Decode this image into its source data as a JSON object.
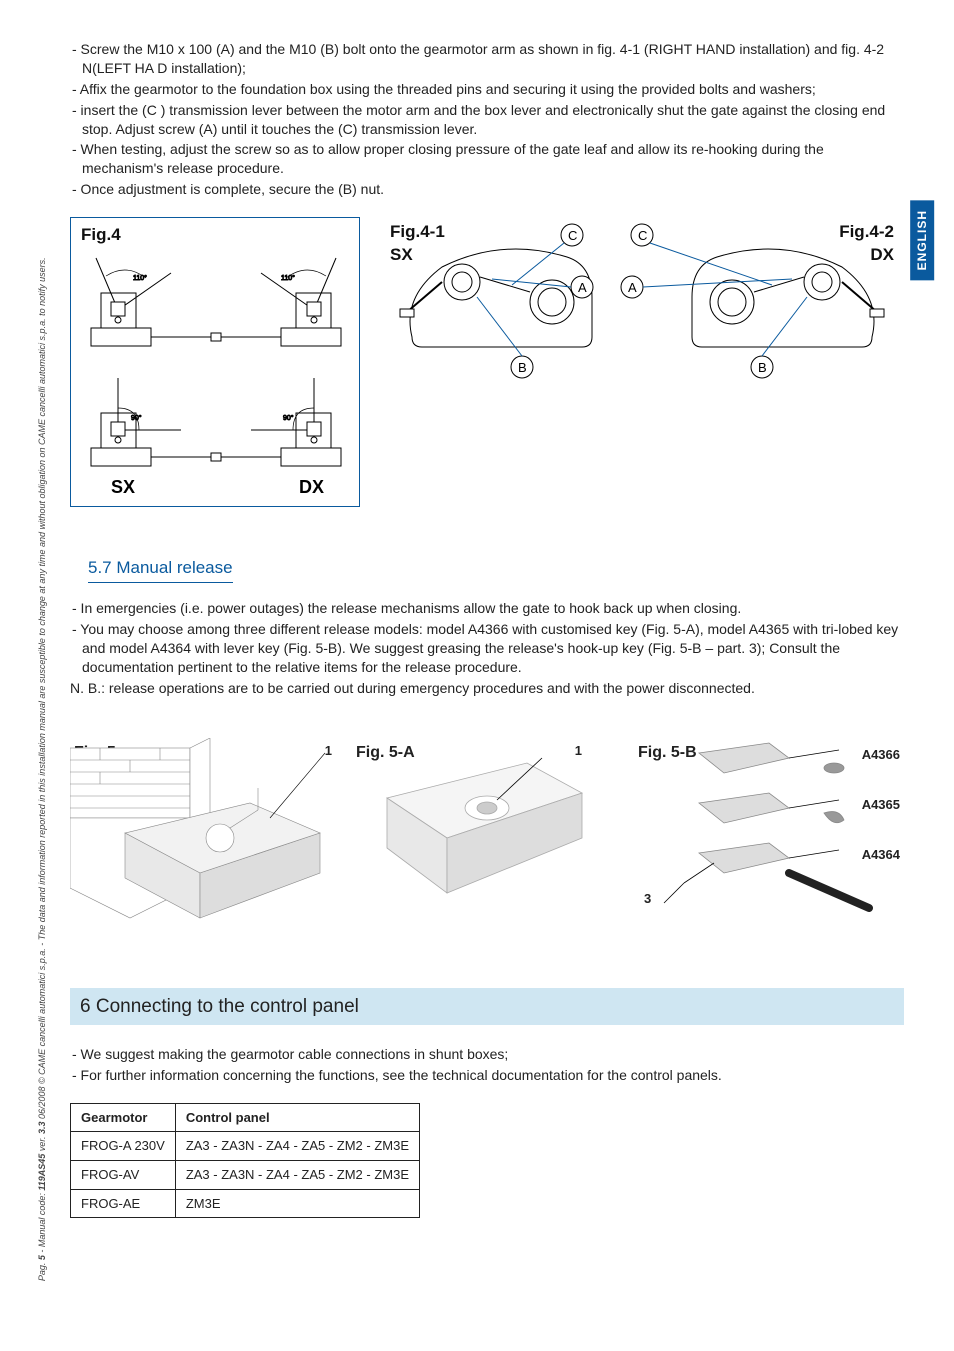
{
  "sideText": {
    "prefix": "Pag. ",
    "page": "5",
    "mid1": " - Manual code: ",
    "code": "119AS45",
    "mid2": " ver. ",
    "ver": "3.3",
    "rest": "  06/2008 © CAME cancelli automatici s.p.a. - The data and information reported in this installation manual are susceptible to change at any time and without obligation on CAME cancelli automatici s.p.a. to notify users."
  },
  "langTab": "ENGLISH",
  "topInstructions": [
    "- Screw the M10 x 100 (A) and the M10 (B) bolt onto the gearmotor arm as shown in fig. 4-1 (RIGHT HAND installation) and fig. 4-2 N(LEFT HA D installation);",
    "- Affix the gearmotor to the foundation box using the threaded pins and securing it using the provided bolts and washers;",
    "- insert the (C ) transmission lever between the motor arm and the box lever and electronically shut the gate against the closing end stop. Adjust screw (A) until it touches the (C) transmission lever.",
    "- When testing, adjust the screw so as to allow proper closing pressure of the gate leaf and allow its re-hooking during the mechanism's release procedure.",
    "- Once adjustment is complete, secure the (B) nut."
  ],
  "fig4": {
    "label": "Fig.4",
    "sx": "SX",
    "dx": "DX",
    "ang110": "110°",
    "ang90": "90°"
  },
  "fig41": {
    "labelL1": "Fig.4-1",
    "labelL2": "SX",
    "labelR1": "Fig.4-2",
    "labelR2": "DX",
    "A": "A",
    "B": "B",
    "C": "C"
  },
  "subsection57": "5.7 Manual release",
  "text57": [
    "- In  emergencies (i.e. power outages) the release mechanisms allow the gate to hook back up when closing.",
    "- You may choose among three different release models: model A4366 with customised key (Fig. 5-A), model A4365 with tri-lobed key and model A4364 with lever key (Fig. 5-B). We suggest greasing the release's hook-up key (Fig. 5-B – part. 3); Consult the documentation pertinent to the relative items for the release procedure."
  ],
  "nb57": "N. B.: release operations are to be carried out during emergency procedures and with the power disconnected.",
  "fig5": {
    "a": {
      "label": "Fig. 5",
      "num1": "1"
    },
    "b": {
      "label": "Fig. 5-A",
      "num1": "1"
    },
    "c": {
      "label": "Fig. 5-B",
      "a1": "A4366",
      "a2": "A4365",
      "a3": "A4364",
      "num3": "3"
    }
  },
  "section6": "6 Connecting to the control panel",
  "text6": [
    "- We suggest making the gearmotor cable connections in shunt boxes;",
    "- For further information concerning the functions, see the technical documentation for the control panels."
  ],
  "table": {
    "headers": [
      "Gearmotor",
      "Control panel"
    ],
    "rows": [
      [
        "FROG-A 230V",
        "ZA3 - ZA3N - ZA4 - ZA5 - ZM2 - ZM3E"
      ],
      [
        "FROG-AV",
        "ZA3 - ZA3N - ZA4 - ZA5 - ZM2 - ZM3E"
      ],
      [
        "FROG-AE",
        "ZM3E"
      ]
    ]
  }
}
